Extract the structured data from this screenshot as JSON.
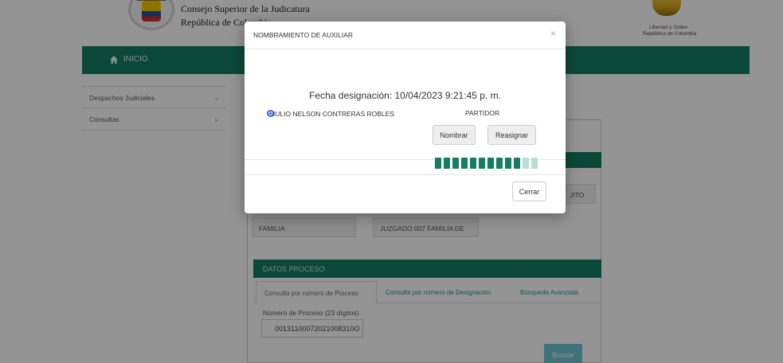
{
  "header": {
    "org_title": "Consejo Superior de la Judicatura",
    "org_subtitle": "República de Colombia",
    "motto_line1": "Libertad y Orden",
    "motto_line2": "República de Colombia"
  },
  "navbar": {
    "home_label": "INICIO",
    "color": "#157d62"
  },
  "sidebar": {
    "items": [
      {
        "label": "Despachos Judiciales"
      },
      {
        "label": "Consultas"
      }
    ]
  },
  "background": {
    "especialidad_value": "FAMILIA",
    "despacho_value": "JUZGADO 007  FAMILIA DE",
    "distrito_fragment": "JITO",
    "datos_proceso_title": "DATOS PROCESO",
    "tabs": [
      {
        "label": "Consulta por número de Proceso"
      },
      {
        "label": "Consulta por número de Designación"
      },
      {
        "label": "Búsqueda Avanzada"
      }
    ],
    "numero_label": "Número de Proceso (23 dígitos)",
    "numero_value": "00131100072021008310O",
    "buscar_label": "Buscar"
  },
  "modal": {
    "title": "NOMBRAMIENTO DE AUXILIAR",
    "close_icon": "×",
    "fecha_label": "Fecha designación: 10/04/2023 9:21:45 p. m.",
    "auxiliar_name": "JULIO NELSON CONTRERAS ROBLES",
    "auxiliar_role": "PARTIDOR",
    "nombrar_label": "Nombrar",
    "reasignar_label": "Reasignar",
    "cerrar_label": "Cerrar",
    "progress": {
      "segments_total": 12,
      "segments_filled": 10
    }
  }
}
